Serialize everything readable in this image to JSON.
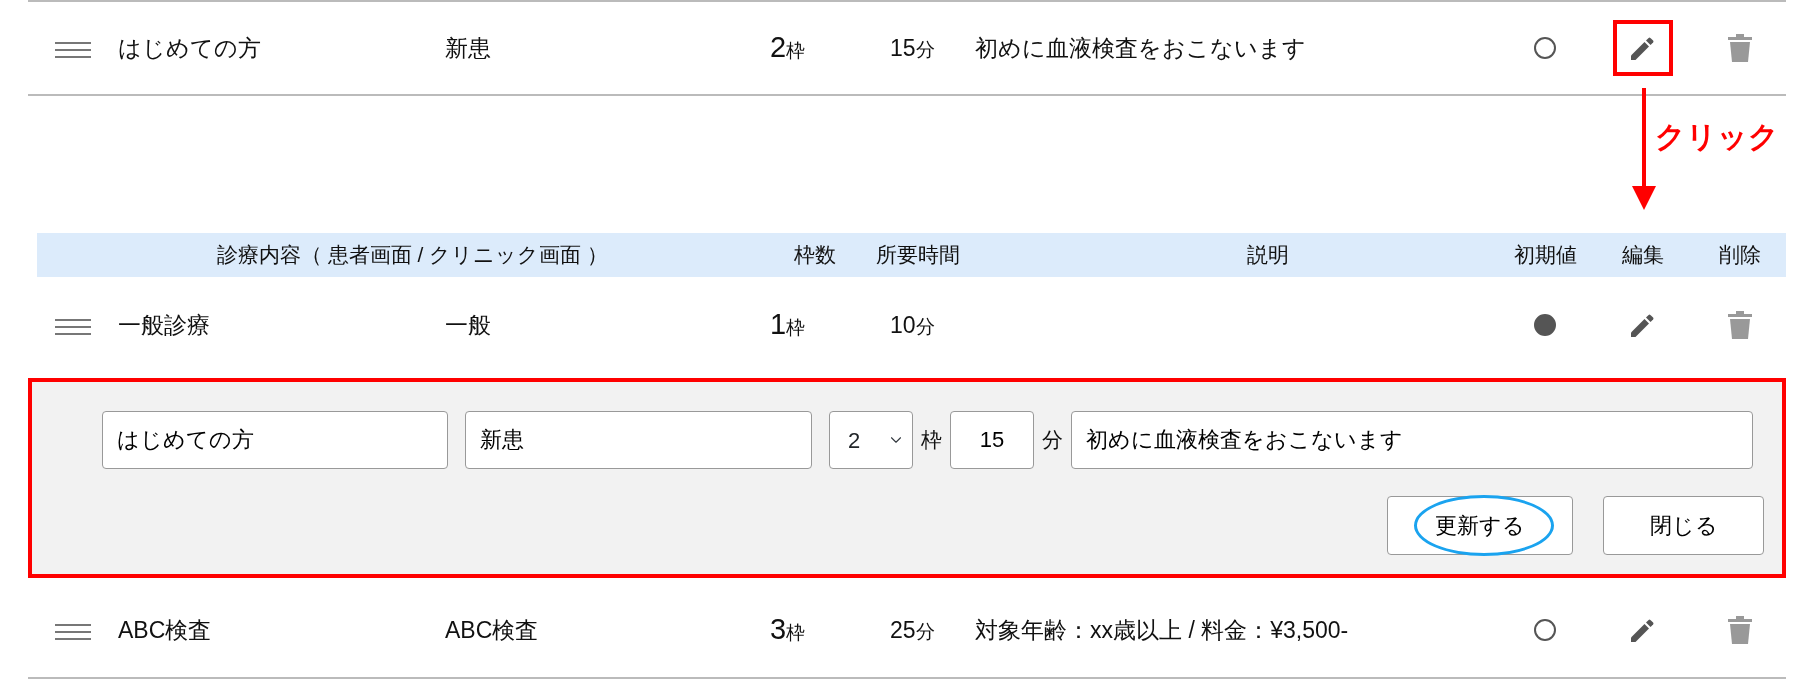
{
  "preview_row": {
    "name": "はじめての方",
    "display_name": "新患",
    "slots": "2",
    "slots_unit": "枠",
    "minutes": "15",
    "minutes_unit": "分",
    "description": "初めに血液検査をおこないます",
    "default": false,
    "edit_highlighted": true
  },
  "annotation": {
    "label": "クリック"
  },
  "table": {
    "columns": [
      "診療内容（ 患者画面 / クリニック画面 ）",
      "枠数",
      "所要時間",
      "説明",
      "初期値",
      "編集",
      "削除"
    ],
    "rows": [
      {
        "kind": "item",
        "name": "一般診療",
        "display_name": "一般",
        "slots": "1",
        "slots_unit": "枠",
        "minutes": "10",
        "minutes_unit": "分",
        "default": true
      },
      {
        "kind": "editor",
        "highlighted": true,
        "name_value": "はじめての方",
        "display_value": "新患",
        "slots_value": "2",
        "slots_label": "枠",
        "minutes_value": "15",
        "minutes_label": "分",
        "description_value": "初めに血液検査をおこないます",
        "buttons": [
          {
            "label": "更新する",
            "circled": true
          },
          {
            "label": "閉じる",
            "circled": false
          }
        ]
      },
      {
        "kind": "item",
        "name": "ABC検査",
        "display_name": "ABC検査",
        "slots": "3",
        "slots_unit": "枠",
        "minutes": "25",
        "minutes_unit": "分",
        "description": "対象年齢：xx歳以上 / 料金：¥3,500-",
        "default": false
      }
    ]
  }
}
